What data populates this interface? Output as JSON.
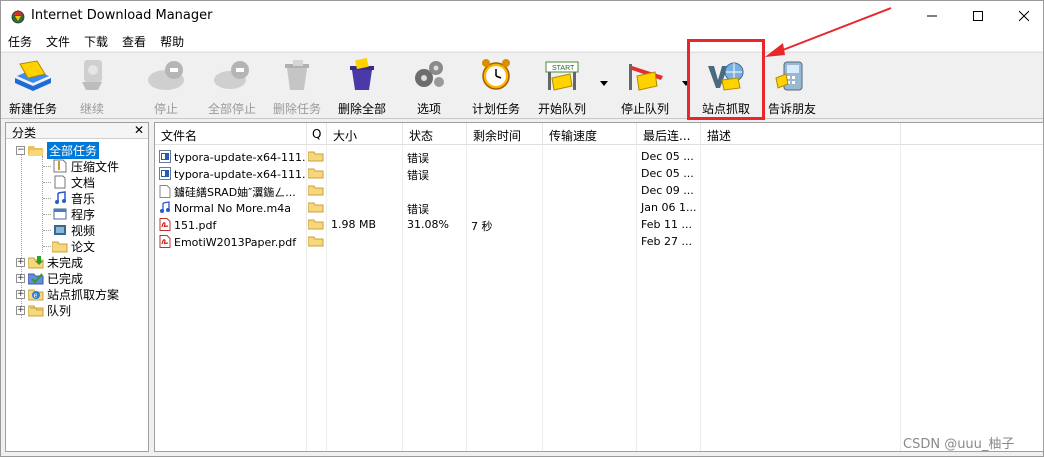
{
  "window": {
    "title": "Internet Download Manager"
  },
  "menu": [
    "任务",
    "文件",
    "下载",
    "查看",
    "帮助"
  ],
  "toolbar": {
    "buttons": [
      {
        "label": "新建任务",
        "icon": "new-task-icon",
        "enabled": true
      },
      {
        "label": "继续",
        "icon": "resume-icon",
        "enabled": false
      },
      {
        "label": "停止",
        "icon": "stop-icon",
        "enabled": false
      },
      {
        "label": "全部停止",
        "icon": "stop-all-icon",
        "enabled": false
      },
      {
        "label": "删除任务",
        "icon": "delete-task-icon",
        "enabled": false
      },
      {
        "label": "删除全部",
        "icon": "delete-all-icon",
        "enabled": true
      },
      {
        "label": "选项",
        "icon": "gears-icon",
        "enabled": true
      },
      {
        "label": "计划任务",
        "icon": "alarm-clock-icon",
        "enabled": true
      },
      {
        "label": "开始队列",
        "icon": "start-queue-icon",
        "enabled": true
      },
      {
        "label": "停止队列",
        "icon": "stop-queue-icon",
        "enabled": true
      },
      {
        "label": "站点抓取",
        "icon": "site-grabber-icon",
        "enabled": true
      },
      {
        "label": "告诉朋友",
        "icon": "tell-friend-icon",
        "enabled": true
      }
    ]
  },
  "sidebar": {
    "header": "分类",
    "close": "✕",
    "root": "全部任务",
    "children": [
      "压缩文件",
      "文档",
      "音乐",
      "程序",
      "视频",
      "论文"
    ],
    "groups": [
      "未完成",
      "已完成",
      "站点抓取方案",
      "队列"
    ],
    "expander_open": "−",
    "expander_closed": "+"
  },
  "table": {
    "columns": [
      "文件名",
      "Q",
      "大小",
      "状态",
      "剩余时间",
      "传输速度",
      "最后连...",
      "描述"
    ],
    "rows": [
      {
        "name": "typora-update-x64-111...",
        "size": "",
        "status": "错误",
        "remaining": "",
        "speed": "",
        "last": "Dec 05 ...",
        "desc": "",
        "type": "installer"
      },
      {
        "name": "typora-update-x64-111...",
        "size": "",
        "status": "错误",
        "remaining": "",
        "speed": "",
        "last": "Dec 05 ...",
        "desc": "",
        "type": "installer"
      },
      {
        "name": "鐪硅繕SRAD妯″瀷鍦ㄥ...",
        "size": "",
        "status": "",
        "remaining": "",
        "speed": "",
        "last": "Dec 09 ...",
        "desc": "",
        "type": "blank"
      },
      {
        "name": "Normal No More.m4a",
        "size": "",
        "status": "错误",
        "remaining": "",
        "speed": "",
        "last": "Jan 06 1...",
        "desc": "",
        "type": "music"
      },
      {
        "name": "151.pdf",
        "size": "1.98  MB",
        "status": "31.08%",
        "remaining": "7 秒",
        "speed": "",
        "last": "Feb 11 ...",
        "desc": "",
        "type": "pdf"
      },
      {
        "name": "EmotiW2013Paper.pdf",
        "size": "",
        "status": "",
        "remaining": "",
        "speed": "",
        "last": "Feb 27 ...",
        "desc": "",
        "type": "pdf"
      }
    ]
  },
  "watermark": "CSDN @uuu_柚子",
  "colors": {
    "highlight": "#e8262b",
    "selection": "#0078d7"
  }
}
